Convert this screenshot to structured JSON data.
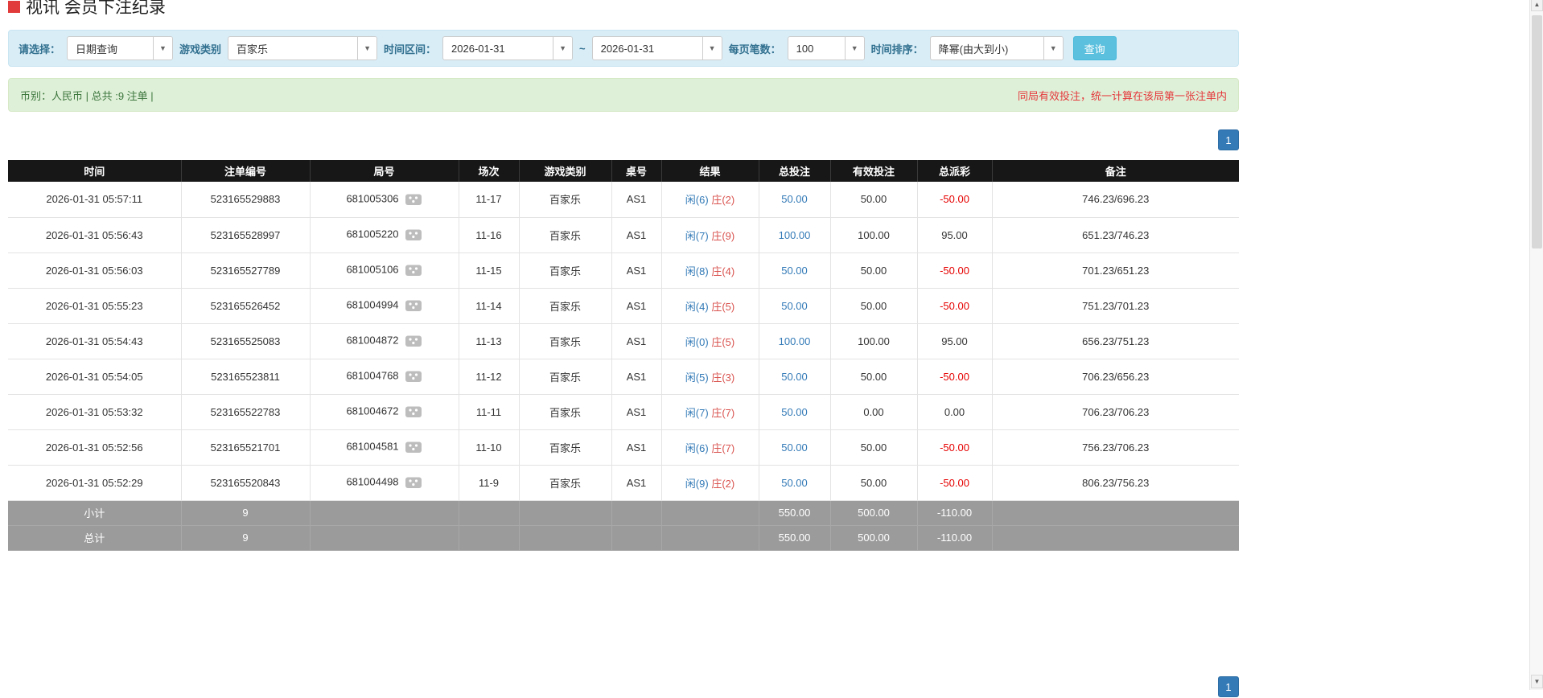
{
  "page": {
    "title": "视讯 会员下注纪录"
  },
  "icons": {
    "caret": "▼",
    "scroll_up": "▲",
    "scroll_down": "▼",
    "round_video_icon": "dice"
  },
  "colors": {
    "link_blue": "#337ab7",
    "player_blue": "#337ab7",
    "banker_red": "#d9534f",
    "negative_red": "#e60000",
    "notice_red": "#e4393c",
    "search_button_blue": "#5bc0de"
  },
  "filters": {
    "select_label": "请选择：",
    "select_value": "日期查询",
    "game_type_label": "游戏类别",
    "game_type_value": "百家乐",
    "time_range_label": "时间区间：",
    "date_from": "2026-01-31",
    "date_separator": "~",
    "date_to": "2026-01-31",
    "per_page_label": "每页笔数：",
    "per_page_value": "100",
    "sort_label": "时间排序：",
    "sort_value": "降幂(由大到小)",
    "search_button": "查询"
  },
  "summary": {
    "left": "币别：人民币 | 总共 :9 注单 |",
    "right": "同局有效投注，统一计算在该局第一张注单内"
  },
  "pagination": {
    "page": "1"
  },
  "table": {
    "headers": [
      "时间",
      "注单编号",
      "局号",
      "场次",
      "游戏类别",
      "桌号",
      "结果",
      "总投注",
      "有效投注",
      "总派彩",
      "备注"
    ],
    "rows": [
      {
        "time": "2026-01-31 05:57:11",
        "bet_id": "523165529883",
        "round_id": "681005306",
        "session": "11-17",
        "game": "百家乐",
        "table": "AS1",
        "player": "闲(6)",
        "banker": "庄(2)",
        "total_bet": "50.00",
        "valid_bet": "50.00",
        "payout": "-50.00",
        "note": "746.23/696.23"
      },
      {
        "time": "2026-01-31 05:56:43",
        "bet_id": "523165528997",
        "round_id": "681005220",
        "session": "11-16",
        "game": "百家乐",
        "table": "AS1",
        "player": "闲(7)",
        "banker": "庄(9)",
        "total_bet": "100.00",
        "valid_bet": "100.00",
        "payout": "95.00",
        "note": "651.23/746.23"
      },
      {
        "time": "2026-01-31 05:56:03",
        "bet_id": "523165527789",
        "round_id": "681005106",
        "session": "11-15",
        "game": "百家乐",
        "table": "AS1",
        "player": "闲(8)",
        "banker": "庄(4)",
        "total_bet": "50.00",
        "valid_bet": "50.00",
        "payout": "-50.00",
        "note": "701.23/651.23"
      },
      {
        "time": "2026-01-31 05:55:23",
        "bet_id": "523165526452",
        "round_id": "681004994",
        "session": "11-14",
        "game": "百家乐",
        "table": "AS1",
        "player": "闲(4)",
        "banker": "庄(5)",
        "total_bet": "50.00",
        "valid_bet": "50.00",
        "payout": "-50.00",
        "note": "751.23/701.23"
      },
      {
        "time": "2026-01-31 05:54:43",
        "bet_id": "523165525083",
        "round_id": "681004872",
        "session": "11-13",
        "game": "百家乐",
        "table": "AS1",
        "player": "闲(0)",
        "banker": "庄(5)",
        "total_bet": "100.00",
        "valid_bet": "100.00",
        "payout": "95.00",
        "note": "656.23/751.23"
      },
      {
        "time": "2026-01-31 05:54:05",
        "bet_id": "523165523811",
        "round_id": "681004768",
        "session": "11-12",
        "game": "百家乐",
        "table": "AS1",
        "player": "闲(5)",
        "banker": "庄(3)",
        "total_bet": "50.00",
        "valid_bet": "50.00",
        "payout": "-50.00",
        "note": "706.23/656.23"
      },
      {
        "time": "2026-01-31 05:53:32",
        "bet_id": "523165522783",
        "round_id": "681004672",
        "session": "11-11",
        "game": "百家乐",
        "table": "AS1",
        "player": "闲(7)",
        "banker": "庄(7)",
        "total_bet": "50.00",
        "valid_bet": "0.00",
        "payout": "0.00",
        "note": "706.23/706.23"
      },
      {
        "time": "2026-01-31 05:52:56",
        "bet_id": "523165521701",
        "round_id": "681004581",
        "session": "11-10",
        "game": "百家乐",
        "table": "AS1",
        "player": "闲(6)",
        "banker": "庄(7)",
        "total_bet": "50.00",
        "valid_bet": "50.00",
        "payout": "-50.00",
        "note": "756.23/706.23"
      },
      {
        "time": "2026-01-31 05:52:29",
        "bet_id": "523165520843",
        "round_id": "681004498",
        "session": "11-9",
        "game": "百家乐",
        "table": "AS1",
        "player": "闲(9)",
        "banker": "庄(2)",
        "total_bet": "50.00",
        "valid_bet": "50.00",
        "payout": "-50.00",
        "note": "806.23/756.23"
      }
    ],
    "subtotal": {
      "label": "小计",
      "count": "9",
      "total_bet": "550.00",
      "valid_bet": "500.00",
      "payout": "-110.00"
    },
    "total": {
      "label": "总计",
      "count": "9",
      "total_bet": "550.00",
      "valid_bet": "500.00",
      "payout": "-110.00"
    }
  }
}
